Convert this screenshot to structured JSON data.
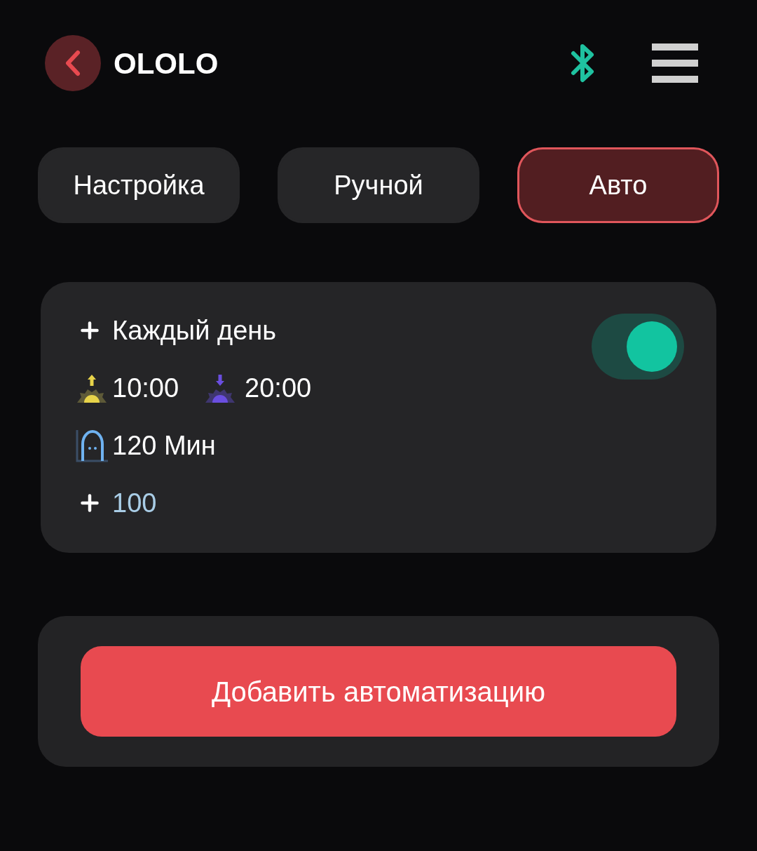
{
  "header": {
    "title": "OLOLO"
  },
  "tabs": [
    {
      "label": "Настройка",
      "selected": false
    },
    {
      "label": "Ручной",
      "selected": false
    },
    {
      "label": "Авто",
      "selected": true
    }
  ],
  "automations": [
    {
      "schedule": "Каждый день",
      "on": true,
      "start": "10:00",
      "end": "20:00",
      "duration": "120 Мин",
      "intensity": "100"
    }
  ],
  "add_button": "Добавить автоматизацию"
}
